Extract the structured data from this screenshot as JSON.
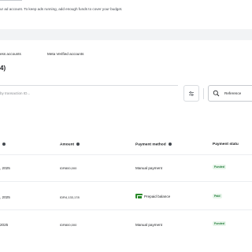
{
  "banner": {
    "notice": "ur ad account. To keep ads running, add enough funds to cover your budget."
  },
  "tabs": [
    {
      "label": "ess accounts"
    },
    {
      "label": "Meta Verified accounts"
    }
  ],
  "transactions_count": "4)",
  "search": {
    "placeholder": "by transaction ID..."
  },
  "filter_icon": "filter-sliders-icon",
  "reference": {
    "icon": "search-icon",
    "label": "Reference"
  },
  "table": {
    "columns": [
      {
        "label": ""
      },
      {
        "label": "Amount"
      },
      {
        "label": "Payment method"
      },
      {
        "label": "Payment statu"
      }
    ],
    "rows": [
      {
        "date": ", 2025",
        "amount": "IDR800,000",
        "method": "Manual payment",
        "status": "Funded"
      },
      {
        "date": ", 2025",
        "amount": "IDR4,133,178",
        "method": "Prepaid balance",
        "status": "Paid"
      },
      {
        "date": "2025",
        "amount": "IDR800,000",
        "method": "Manual payment",
        "status": "Funded"
      }
    ]
  },
  "colors": {
    "status_text": "#1e7a36",
    "status_bg": "#e6f4e9",
    "prepaid_icon": "#2a8a2a"
  }
}
